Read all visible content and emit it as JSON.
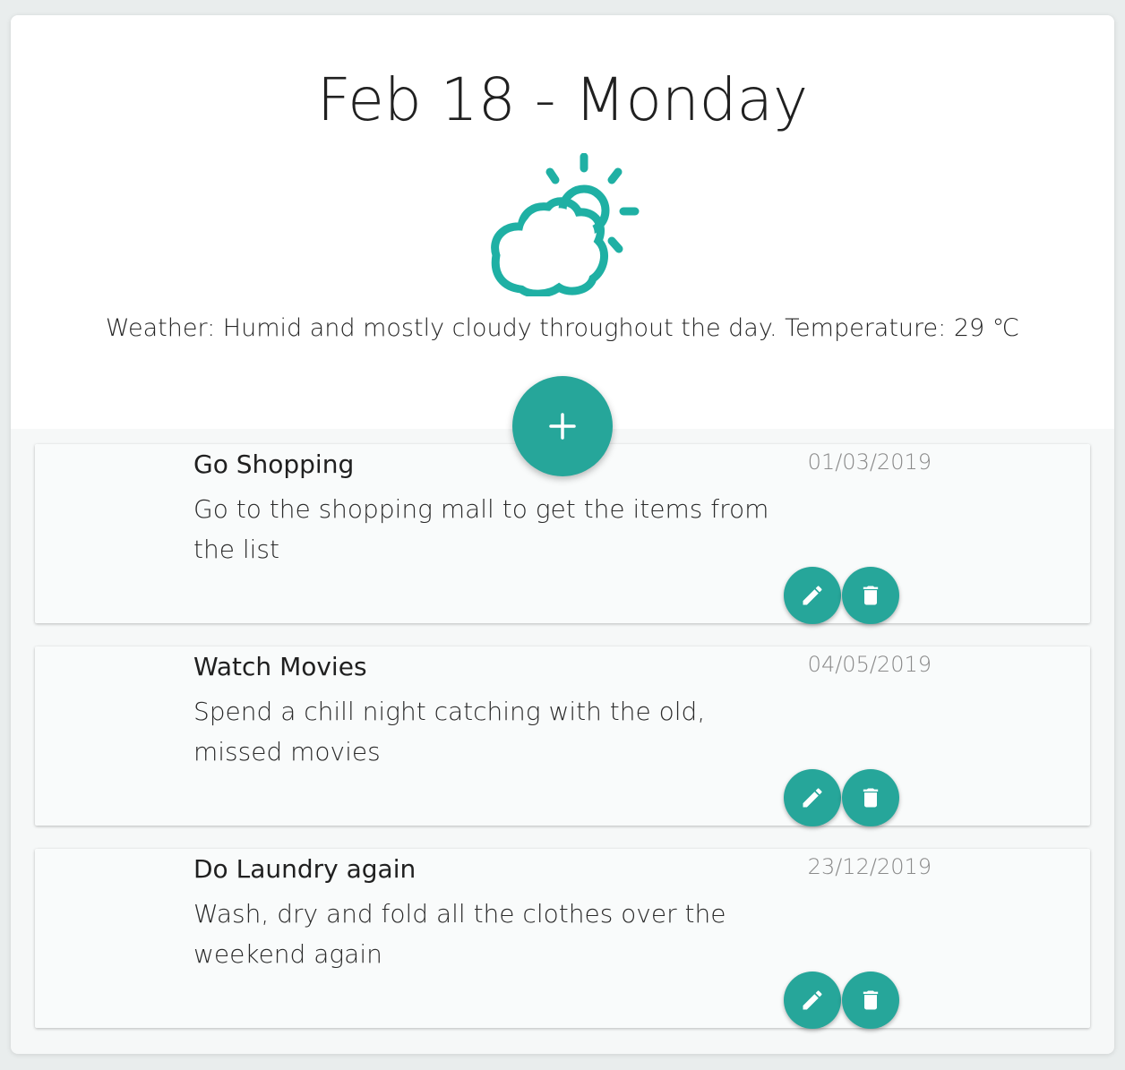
{
  "header": {
    "date_title": "Feb 18 - Monday",
    "weather_icon": "partly-cloudy-icon",
    "weather_text": "Weather: Humid and mostly cloudy throughout the day. Temperature: 29 ℃",
    "accent_color": "#26a69a"
  },
  "add_button": {
    "icon": "plus-icon"
  },
  "todos": [
    {
      "title": "Go Shopping",
      "description": "Go to the shopping mall to get the items from the list",
      "date": "01/03/2019",
      "edit_icon": "pencil-icon",
      "delete_icon": "trash-icon"
    },
    {
      "title": "Watch Movies",
      "description": "Spend a chill night catching with the old, missed movies",
      "date": "04/05/2019",
      "edit_icon": "pencil-icon",
      "delete_icon": "trash-icon"
    },
    {
      "title": "Do Laundry again",
      "description": "Wash, dry and fold all the clothes over the weekend again",
      "date": "23/12/2019",
      "edit_icon": "pencil-icon",
      "delete_icon": "trash-icon"
    }
  ]
}
